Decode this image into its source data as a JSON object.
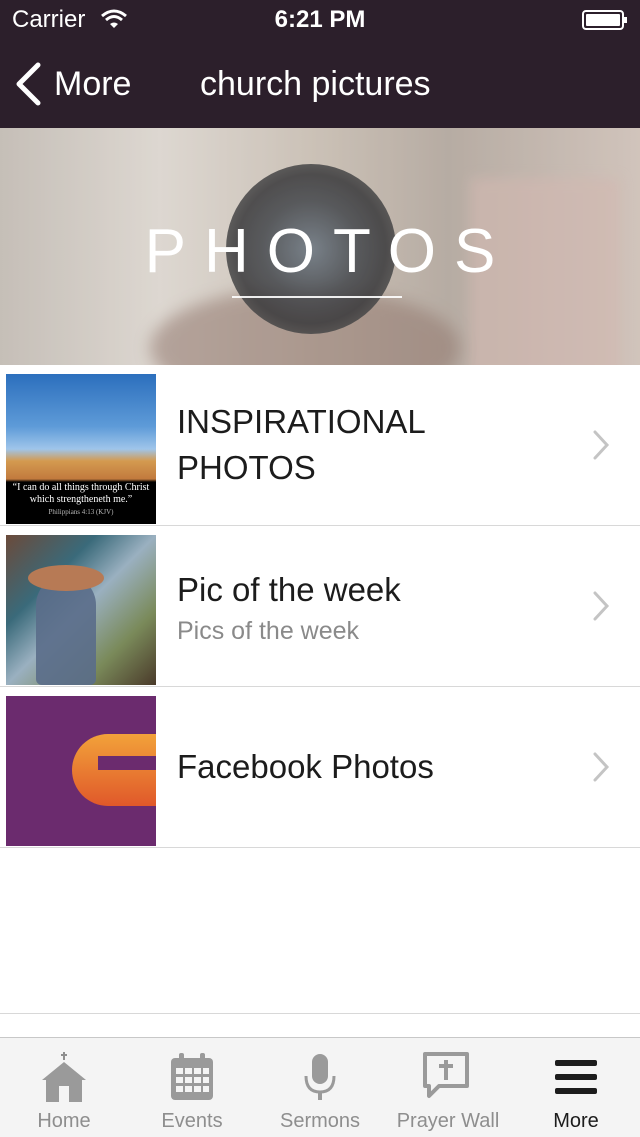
{
  "status_bar": {
    "carrier": "Carrier",
    "time": "6:21 PM"
  },
  "nav": {
    "back_label": "More",
    "title": "church pictures"
  },
  "hero": {
    "title": "PHOTOS"
  },
  "albums": [
    {
      "title": "INSPIRATIONAL PHOTOS",
      "subtitle": "",
      "thumb_caption": "“I can do all things through Christ which strengtheneth me.”",
      "thumb_ref": "Philippians 4:13 (KJV)"
    },
    {
      "title": "Pic of the week",
      "subtitle": "Pics of the week"
    },
    {
      "title": "Facebook Photos",
      "subtitle": ""
    }
  ],
  "tabs": [
    {
      "label": "Home",
      "icon": "church-icon",
      "active": false
    },
    {
      "label": "Events",
      "icon": "calendar-icon",
      "active": false
    },
    {
      "label": "Sermons",
      "icon": "microphone-icon",
      "active": false
    },
    {
      "label": "Prayer Wall",
      "icon": "cross-bubble-icon",
      "active": false
    },
    {
      "label": "More",
      "icon": "menu-icon",
      "active": true
    }
  ],
  "colors": {
    "nav_bg": "#2c1f2b",
    "tab_active": "#1c1c1c",
    "tab_inactive": "#8e8e8e"
  }
}
